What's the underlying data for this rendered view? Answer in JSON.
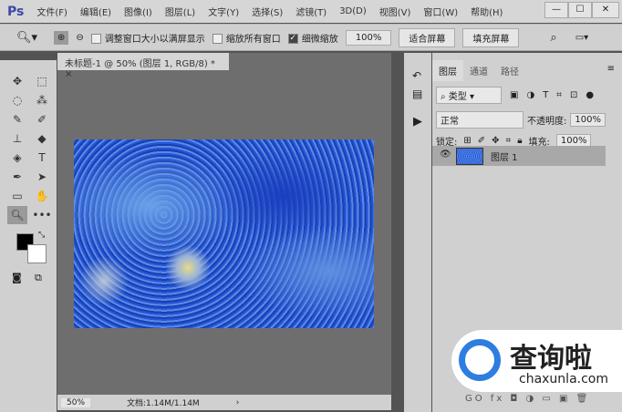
{
  "app": {
    "logo": "Ps",
    "menus": [
      "文件(F)",
      "编辑(E)",
      "图像(I)",
      "图层(L)",
      "文字(Y)",
      "选择(S)",
      "滤镜(T)",
      "3D(D)",
      "视图(V)",
      "窗口(W)",
      "帮助(H)"
    ],
    "win": [
      "—",
      "☐",
      "✕"
    ]
  },
  "options": {
    "resize_windows": "调整窗口大小以满屏显示",
    "zoom_all": "缩放所有窗口",
    "scrubby_zoom": "细微缩放",
    "zoom_value": "100%",
    "fit_screen": "适合屏幕",
    "fill_screen": "填充屏幕"
  },
  "document": {
    "tab": "未标题-1 @ 50% (图层 1, RGB/8) *",
    "close": "×",
    "zoom": "50%",
    "doc_info": "文档:1.14M/1.14M",
    "arrow": "›"
  },
  "layers": {
    "tabs": [
      "图层",
      "通道",
      "路径"
    ],
    "filter": "类型",
    "blend": "正常",
    "opacity_label": "不透明度:",
    "opacity": "100%",
    "lock_label": "锁定:",
    "fill_label": "填充:",
    "fill": "100%",
    "layer_name": "图层 1",
    "bottom_icons": "GO fx ◘ ◑ ▭ ▣ 🗑"
  },
  "watermark": {
    "name": "查询啦",
    "url": "chaxunla.com"
  }
}
